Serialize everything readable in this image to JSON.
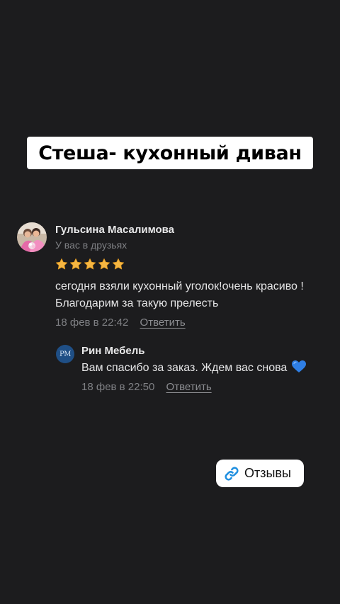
{
  "banner": {
    "title": "Стеша- кухонный диван"
  },
  "review": {
    "author": "Гульсина Масалимова",
    "friend_status": "У вас в друзьях",
    "rating": 5,
    "rating_max": 5,
    "text": "сегодня взяли кухонный уголок!очень красиво ! Благодарим за такую прелесть",
    "date": "18 фев в 22:42",
    "reply_label": "Ответить"
  },
  "shop_reply": {
    "author": "Рин Мебель",
    "avatar_initials": "PM",
    "text": "Вам спасибо за заказ. Ждем вас снова",
    "emoji": "blue-heart-icon",
    "date": "18 фев в 22:50",
    "reply_label": "Ответить"
  },
  "sticker": {
    "label": "Отзывы",
    "icon": "link-icon"
  },
  "colors": {
    "background": "#1c1c1e",
    "star": "#f5b642",
    "heart": "#2f7fe5",
    "link_icon": "#1f8fe0",
    "shop_avatar": "#1f4f86"
  }
}
